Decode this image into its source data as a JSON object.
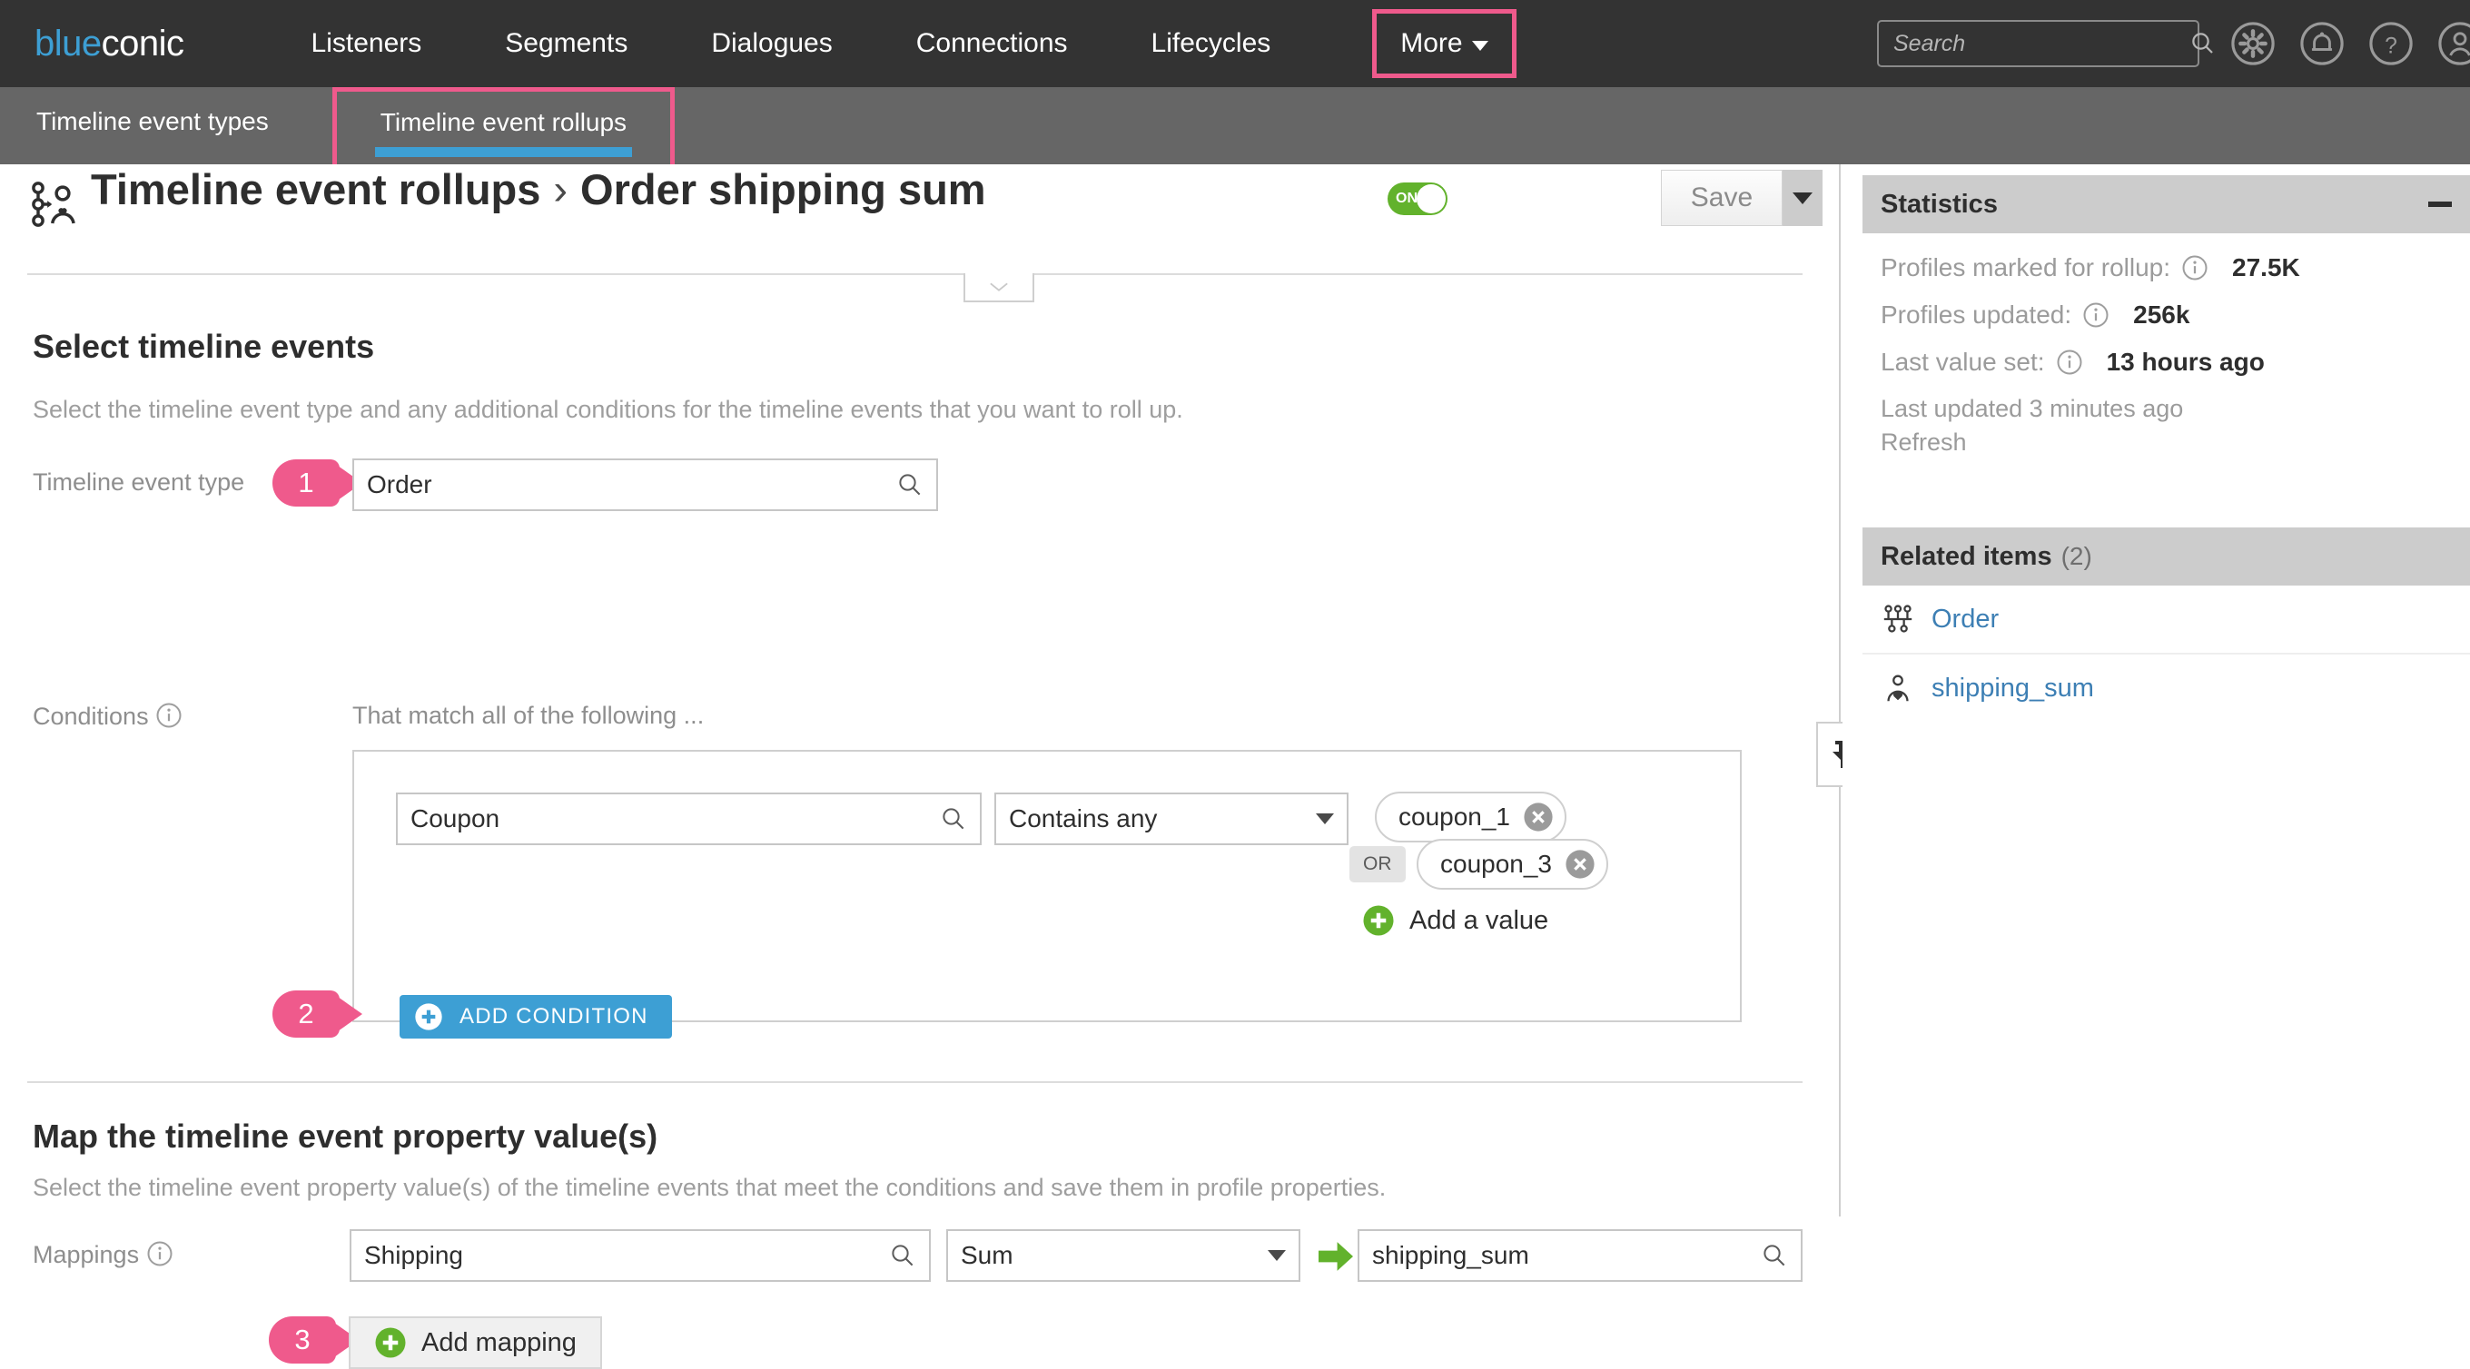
{
  "topnav": {
    "logo_blue": "blue",
    "logo_dark": "conic",
    "items": [
      {
        "label": "Listeners"
      },
      {
        "label": "Segments"
      },
      {
        "label": "Dialogues"
      },
      {
        "label": "Connections"
      },
      {
        "label": "Lifecycles"
      }
    ],
    "more_label": "More",
    "search_placeholder": "Search",
    "search_value": "",
    "icons": [
      "gear-icon",
      "bell-icon",
      "help-icon",
      "user-icon"
    ],
    "highlight_color": "#ef5a8c"
  },
  "subnav": {
    "tabs": [
      {
        "label": "Timeline event types",
        "active": false
      },
      {
        "label": "Timeline event rollups",
        "active": true
      }
    ],
    "active_underline_color": "#3d9fd4"
  },
  "header": {
    "breadcrumb_parent": "Timeline event rollups",
    "separator": "›",
    "breadcrumb_current": "Order shipping sum",
    "toggle_state": "ON",
    "toggle_color": "#62b22c",
    "save_label": "Save"
  },
  "select_events": {
    "title": "Select timeline events",
    "description": "Select the timeline event type and any additional conditions for the timeline events that you want to roll up.",
    "event_type_label": "Timeline event type",
    "event_type_value": "Order",
    "badge_1": "1",
    "conditions_label": "Conditions",
    "conditions_intro": "That match all of the following ...",
    "condition": {
      "property_value": "Coupon",
      "operator_value": "Contains any",
      "values": [
        "coupon_1",
        "coupon_3"
      ],
      "or_label": "OR",
      "add_value_label": "Add a value"
    },
    "add_condition_label": "ADD CONDITION",
    "badge_2": "2"
  },
  "map_values": {
    "title": "Map the timeline event property value(s)",
    "description": "Select the timeline event property value(s) of the timeline events that meet the conditions and save them in profile properties.",
    "mappings_label": "Mappings",
    "source_value": "Shipping",
    "function_value": "Sum",
    "target_value": "shipping_sum",
    "add_mapping_label": "Add mapping",
    "badge_3": "3"
  },
  "sidebar": {
    "statistics": {
      "title": "Statistics",
      "rows": [
        {
          "label": "Profiles marked for rollup:",
          "value": "27.5K"
        },
        {
          "label": "Profiles updated:",
          "value": "256k"
        },
        {
          "label": "Last value set:",
          "value": "13 hours ago"
        }
      ],
      "last_updated": "Last updated 3 minutes ago",
      "refresh_label": "Refresh"
    },
    "related_items": {
      "title": "Related items",
      "count": "(2)",
      "items": [
        {
          "label": "Order",
          "icon": "timeline-event-icon"
        },
        {
          "label": "shipping_sum",
          "icon": "profile-property-icon"
        }
      ]
    }
  }
}
